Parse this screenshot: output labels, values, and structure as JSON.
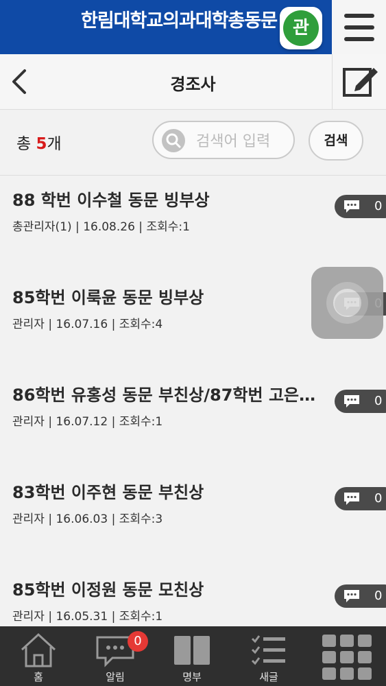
{
  "app_title": "한림대학교의과대학총동문",
  "app_badge": "관",
  "page_title": "경조사",
  "total": {
    "prefix": "총",
    "count": "5",
    "suffix": "개"
  },
  "search": {
    "placeholder": "검색어 입력",
    "button": "검색"
  },
  "posts": [
    {
      "title": "88 학번 이수철 동문 빙부상",
      "author": "총관리자(1)",
      "date": "16.08.26",
      "views": "조회수:1",
      "comments": "0"
    },
    {
      "title": "85학번 이룩윤 동문 빙부상",
      "author": "관리자",
      "date": "16.07.16",
      "views": "조회수:4",
      "comments": "0"
    },
    {
      "title": "86학번 유홍성 동문 부친상/87학번 고은…",
      "author": "관리자",
      "date": "16.07.12",
      "views": "조회수:1",
      "comments": "0"
    },
    {
      "title": "83학번 이주현 동문 부친상",
      "author": "관리자",
      "date": "16.06.03",
      "views": "조회수:3",
      "comments": "0"
    },
    {
      "title": "85학번 이정원 동문 모친상",
      "author": "관리자",
      "date": "16.05.31",
      "views": "조회수:1",
      "comments": "0"
    }
  ],
  "bottom_nav": [
    {
      "label": "홈",
      "icon": "home-icon"
    },
    {
      "label": "알림",
      "icon": "chat-icon",
      "badge": "0"
    },
    {
      "label": "명부",
      "icon": "book-icon"
    },
    {
      "label": "새글",
      "icon": "checklist-icon"
    },
    {
      "label": "",
      "icon": "grid-menu-icon"
    }
  ],
  "colors": {
    "header": "#0f4aa6",
    "accent_red": "#d81b1b",
    "nav_bg": "#2f2f2f",
    "badge_green": "#2f9e3b"
  }
}
